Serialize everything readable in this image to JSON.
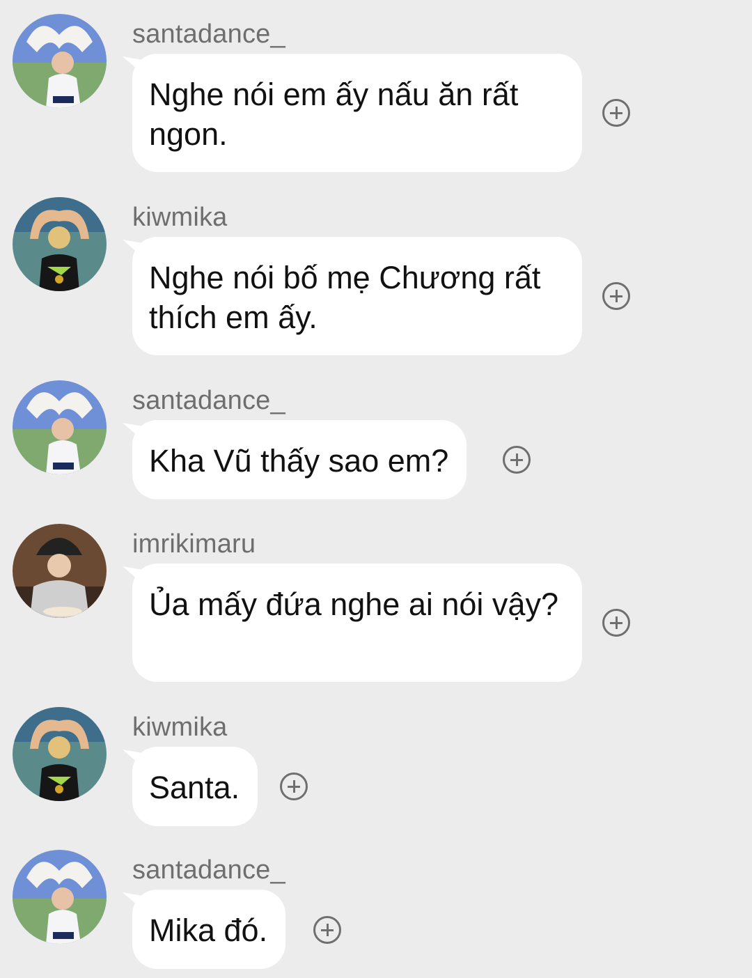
{
  "icons": {
    "avatar": "profile-photo",
    "add_reaction": "circle-plus-icon"
  },
  "colors": {
    "background": "#ececec",
    "bubble": "#ffffff",
    "username": "#6e6e6e",
    "text": "#111111",
    "icon": "#6f6f6f"
  },
  "messages": [
    {
      "username": "santadance_",
      "text": "Nghe nói em ấy nấu ăn rất ngon."
    },
    {
      "username": "kiwmika",
      "text": "Nghe nói bố mẹ Chương rất thích em ấy."
    },
    {
      "username": "santadance_",
      "text": "Kha Vũ thấy sao em?"
    },
    {
      "username": "imrikimaru",
      "text": "Ủa mấy đứa nghe ai nói vậy?"
    },
    {
      "username": "kiwmika",
      "text": "Santa."
    },
    {
      "username": "santadance_",
      "text": "Mika đó."
    }
  ]
}
